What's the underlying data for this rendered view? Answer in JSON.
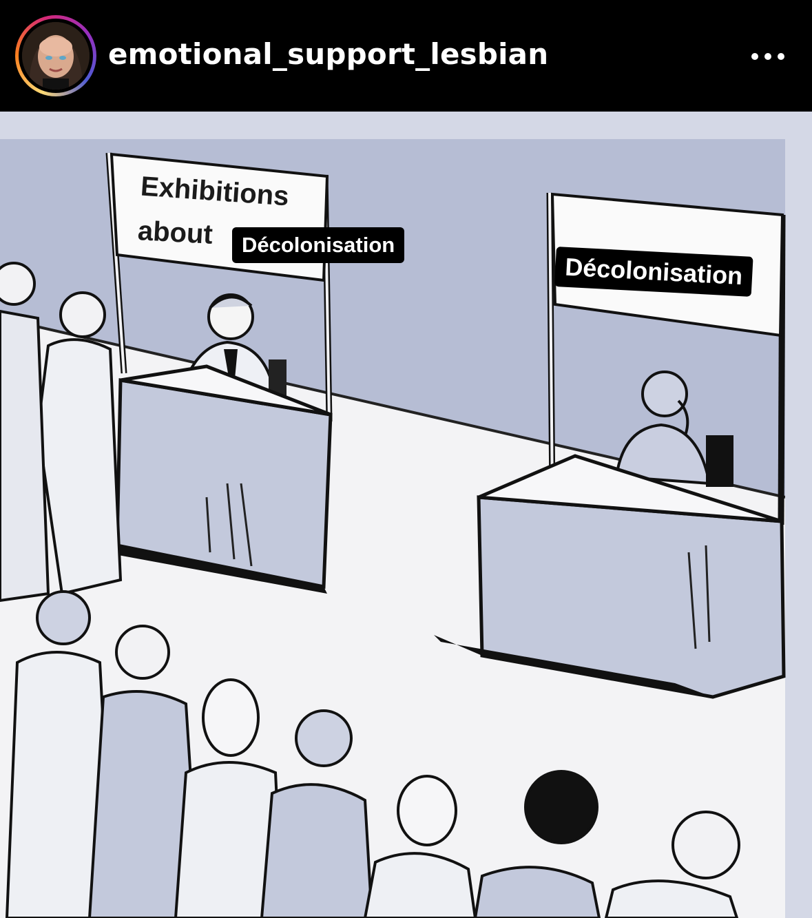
{
  "header": {
    "username": "emotional_support_lesbian",
    "more_icon": "ellipsis-horizontal-icon"
  },
  "meme": {
    "left_sign": {
      "line1": "Exhibitions",
      "line2": "about",
      "tag": "Décolonisation"
    },
    "right_sign": {
      "tag": "Décolonisation"
    }
  },
  "colors": {
    "header_bg": "#000000",
    "illustration_bg": "#b9c0d6",
    "floor": "#f2f2f4"
  }
}
